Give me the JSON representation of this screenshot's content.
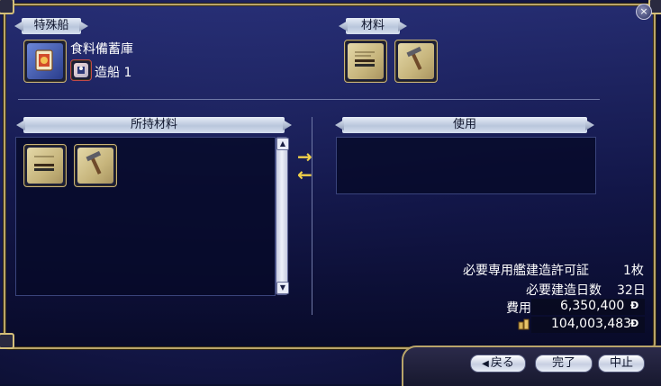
{
  "window": {
    "close_glyph": "×"
  },
  "special_ship": {
    "label": "特殊船",
    "name": "食料備蓄庫",
    "requirement": "造船 1"
  },
  "materials": {
    "label": "材料"
  },
  "owned_materials": {
    "label": "所持材料"
  },
  "usage": {
    "label": "使用"
  },
  "info": {
    "permit_label": "必要専用艦建造許可証",
    "permit_value": "1枚",
    "days_label": "必要建造日数",
    "days_value": "32日",
    "cost_label": "費用",
    "cost_value": "6,350,400",
    "funds_value": "104,003,483",
    "currency_glyph": "Ð"
  },
  "buttons": {
    "back": "戻る",
    "complete": "完了",
    "cancel": "中止"
  },
  "icons": {
    "ship_icon": "ship-icon",
    "shipbuilding_icon": "shipbuilding-icon",
    "blueprint_icon": "blueprint-icon",
    "hammer_icon": "hammer-icon",
    "coin_icon": "coin-icon"
  },
  "colors": {
    "accent_gold": "#b9a56a",
    "arrow_yellow": "#f1d04a",
    "panel_blue": "#0a1040"
  }
}
